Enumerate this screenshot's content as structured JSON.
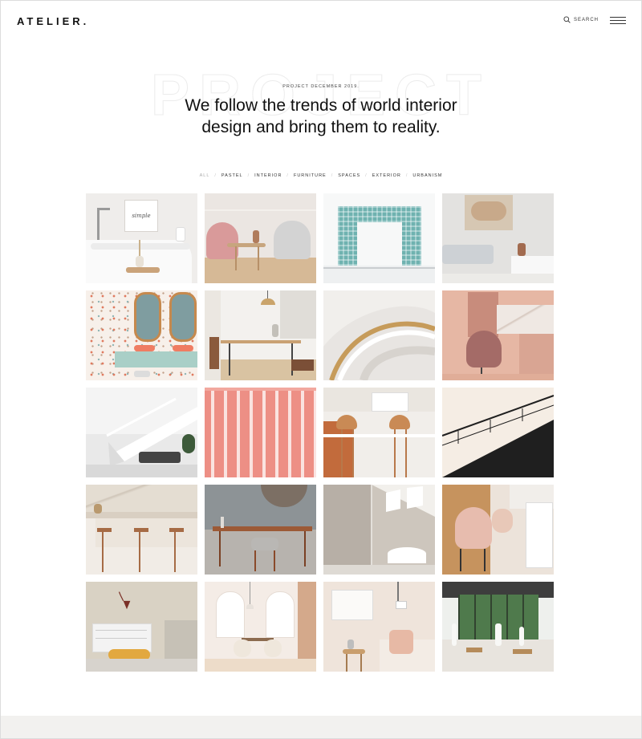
{
  "header": {
    "logo": "ATELIER.",
    "search_label": "SEARCH"
  },
  "hero": {
    "eyebrow": "PROJECT DECEMBER 2019.",
    "title_line1": "We follow the trends of world interior",
    "title_line2": "design and bring them to reality."
  },
  "filters": [
    "ALL",
    "PASTEL",
    "INTERIOR",
    "FURNITURE",
    "SPACES",
    "EXTERIOR",
    "URBANISM"
  ],
  "gallery": {
    "tile_1_art_text": "simple"
  }
}
